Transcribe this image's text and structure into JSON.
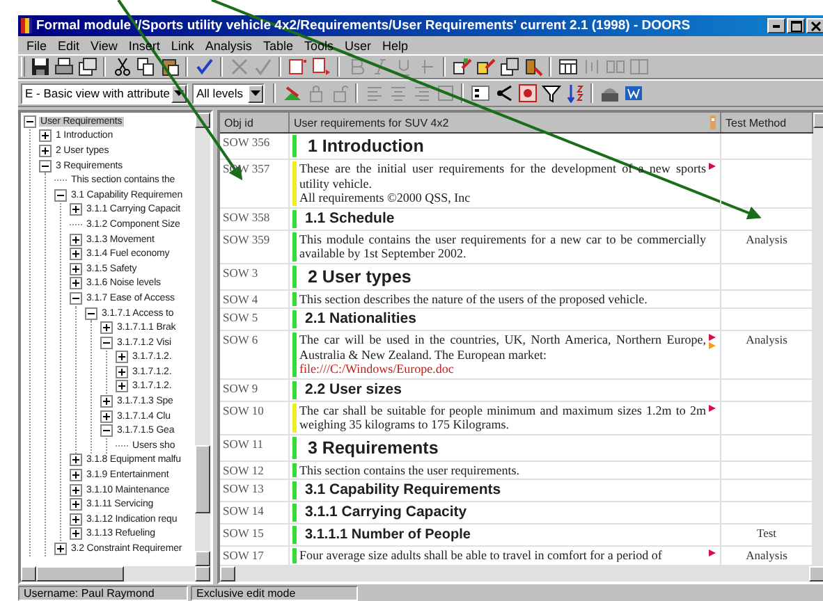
{
  "window": {
    "title": "Formal module '/Sports utility vehicle 4x2/Requirements/User Requirements' current 2.1 (1998) - DOORS"
  },
  "menu": [
    "File",
    "Edit",
    "View",
    "Insert",
    "Link",
    "Analysis",
    "Table",
    "Tools",
    "User",
    "Help"
  ],
  "view_select": {
    "value": "E - Basic view with attribute"
  },
  "level_select": {
    "value": "All levels"
  },
  "tree": [
    {
      "label": "User Requirements",
      "kind": "branch",
      "expanded": true,
      "selected": true,
      "children": [
        {
          "label": "1 Introduction",
          "kind": "branch",
          "expanded": false,
          "selected": false
        },
        {
          "label": "2 User types",
          "kind": "branch",
          "expanded": false,
          "selected": false
        },
        {
          "label": "3 Requirements",
          "kind": "branch",
          "expanded": true,
          "selected": false,
          "children": [
            {
              "label": "This section contains the",
              "kind": "leaf",
              "selected": false
            },
            {
              "label": "3.1 Capability Requiremen",
              "kind": "branch",
              "expanded": true,
              "selected": false,
              "children": [
                {
                  "label": "3.1.1 Carrying Capacit",
                  "kind": "branch",
                  "expanded": false,
                  "selected": false
                },
                {
                  "label": "3.1.2 Component Size",
                  "kind": "leaf",
                  "selected": false
                },
                {
                  "label": "3.1.3 Movement",
                  "kind": "branch",
                  "expanded": false,
                  "selected": false
                },
                {
                  "label": "3.1.4 Fuel economy",
                  "kind": "branch",
                  "expanded": false,
                  "selected": false
                },
                {
                  "label": "3.1.5 Safety",
                  "kind": "branch",
                  "expanded": false,
                  "selected": false
                },
                {
                  "label": "3.1.6 Noise levels",
                  "kind": "branch",
                  "expanded": false,
                  "selected": false
                },
                {
                  "label": "3.1.7 Ease of Access",
                  "kind": "branch",
                  "expanded": true,
                  "selected": false,
                  "children": [
                    {
                      "label": "3.1.7.1 Access to",
                      "kind": "branch",
                      "expanded": true,
                      "selected": false,
                      "children": [
                        {
                          "label": "3.1.7.1.1 Brak",
                          "kind": "branch",
                          "expanded": false,
                          "selected": false
                        },
                        {
                          "label": "3.1.7.1.2 Visi",
                          "kind": "branch",
                          "expanded": true,
                          "selected": false,
                          "children": [
                            {
                              "label": "3.1.7.1.2.",
                              "kind": "branch",
                              "expanded": false,
                              "selected": false
                            },
                            {
                              "label": "3.1.7.1.2.",
                              "kind": "branch",
                              "expanded": false,
                              "selected": false
                            },
                            {
                              "label": "3.1.7.1.2.",
                              "kind": "branch",
                              "expanded": false,
                              "selected": false
                            }
                          ]
                        },
                        {
                          "label": "3.1.7.1.3 Spe",
                          "kind": "branch",
                          "expanded": false,
                          "selected": false
                        },
                        {
                          "label": "3.1.7.1.4 Clu",
                          "kind": "branch",
                          "expanded": false,
                          "selected": false
                        },
                        {
                          "label": "3.1.7.1.5 Gea",
                          "kind": "branch",
                          "expanded": true,
                          "selected": false,
                          "children": [
                            {
                              "label": "Users sho",
                              "kind": "leaf",
                              "selected": false
                            }
                          ]
                        }
                      ]
                    }
                  ]
                },
                {
                  "label": "3.1.8 Equipment malfu",
                  "kind": "branch",
                  "expanded": false,
                  "selected": false
                },
                {
                  "label": "3.1.9 Entertainment",
                  "kind": "branch",
                  "expanded": false,
                  "selected": false
                },
                {
                  "label": "3.1.10 Maintenance",
                  "kind": "branch",
                  "expanded": false,
                  "selected": false
                },
                {
                  "label": "3.1.11 Servicing",
                  "kind": "branch",
                  "expanded": false,
                  "selected": false
                },
                {
                  "label": "3.1.12 Indication requ",
                  "kind": "branch",
                  "expanded": false,
                  "selected": false
                },
                {
                  "label": "3.1.13 Refueling",
                  "kind": "branch",
                  "expanded": false,
                  "selected": false
                }
              ]
            },
            {
              "label": "3.2 Constraint Requiremer",
              "kind": "branch",
              "expanded": false,
              "selected": false
            }
          ]
        }
      ]
    }
  ],
  "table": {
    "columns": [
      "Obj id",
      "User requirements for SUV 4x2",
      "Test Method"
    ],
    "rows": [
      {
        "id": "SOW 356",
        "kind": "heading1",
        "text": "1 Introduction",
        "color": "#33dd33"
      },
      {
        "id": "SOW 357",
        "kind": "text",
        "text": "These are the initial user requirements for the development of a new sports utility vehicle.\nAll requirements ©2000 QSS, Inc",
        "color": "#eeee22",
        "flags": [
          {
            "color": "#d0104a"
          }
        ]
      },
      {
        "id": "SOW 358",
        "kind": "heading2",
        "text": "1.1 Schedule",
        "color": "#33dd33"
      },
      {
        "id": "SOW 359",
        "kind": "text",
        "text": "This module contains the user requirements for a new car to be commercially available by 1st September 2002.",
        "color": "#33dd33",
        "test_method": "Analysis"
      },
      {
        "id": "SOW 3",
        "kind": "heading1",
        "text": "2 User types",
        "color": "#33dd33"
      },
      {
        "id": "SOW 4",
        "kind": "text",
        "text": "This section describes the nature of the users of the proposed vehicle.",
        "color": "#33dd33"
      },
      {
        "id": "SOW 5",
        "kind": "heading2",
        "text": "2.1 Nationalities",
        "color": "#33dd33"
      },
      {
        "id": "SOW 6",
        "kind": "text",
        "text": "The car will be used in the countries, UK, North America, Northern Europe, Australia & New Zealand. The European market:",
        "link": "file:///C:/Windows/Europe.doc",
        "color": "#33dd33",
        "test_method": "Analysis",
        "flags": [
          {
            "color": "#d0104a"
          },
          {
            "color": "#f0a020"
          }
        ]
      },
      {
        "id": "SOW 9",
        "kind": "heading2",
        "text": "2.2 User sizes",
        "color": "#33dd33"
      },
      {
        "id": "SOW 10",
        "kind": "text",
        "text": "The car shall be suitable for people minimum and maximum sizes 1.2m to 2m weighing 35 kilograms to 175 Kilograms.",
        "color": "#eeee22",
        "flags": [
          {
            "color": "#d0104a"
          }
        ]
      },
      {
        "id": "SOW 11",
        "kind": "heading1",
        "text": "3 Requirements",
        "color": "#33dd33"
      },
      {
        "id": "SOW 12",
        "kind": "text",
        "text": "This section contains the user requirements.",
        "color": "#33dd33"
      },
      {
        "id": "SOW 13",
        "kind": "heading2",
        "text": "3.1 Capability Requirements",
        "color": "#33dd33"
      },
      {
        "id": "SOW 14",
        "kind": "heading2",
        "text": "3.1.1 Carrying Capacity",
        "color": "#33dd33"
      },
      {
        "id": "SOW 15",
        "kind": "heading3",
        "text": "3.1.1.1 Number of People",
        "color": "#33dd33",
        "test_method": "Test"
      },
      {
        "id": "SOW 17",
        "kind": "text",
        "text": "Four average size adults shall be able to travel in comfort for a period of",
        "color": "#33dd33",
        "test_method": "Analysis",
        "flags": [
          {
            "color": "#d0104a"
          }
        ]
      }
    ]
  },
  "status_bar": [
    "Username: Paul Raymond",
    "Exclusive edit mode"
  ]
}
